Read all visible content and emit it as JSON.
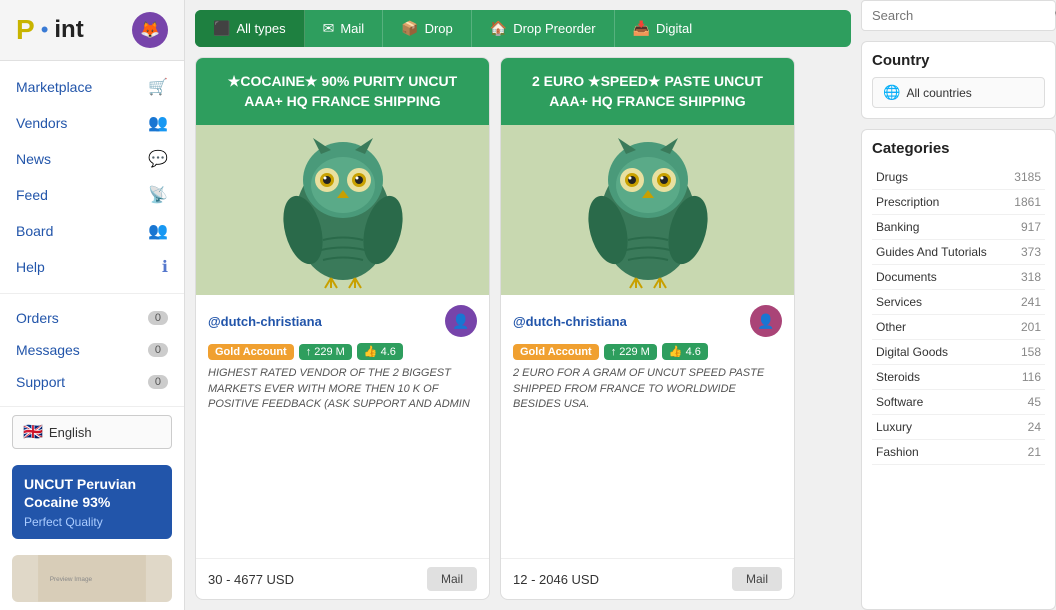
{
  "logo": {
    "p": "P",
    "dot": "•",
    "int": "int"
  },
  "sidebar": {
    "nav_items": [
      {
        "label": "Marketplace",
        "icon": "🛒",
        "badge": null
      },
      {
        "label": "Vendors",
        "icon": "👥",
        "badge": null
      },
      {
        "label": "News",
        "icon": "💬",
        "badge": null
      },
      {
        "label": "Feed",
        "icon": "📡",
        "badge": null
      },
      {
        "label": "Board",
        "icon": "👥",
        "badge": null
      },
      {
        "label": "Help",
        "icon": "ℹ",
        "badge": null
      }
    ],
    "account_items": [
      {
        "label": "Orders",
        "badge": "0"
      },
      {
        "label": "Messages",
        "badge": "0"
      },
      {
        "label": "Support",
        "badge": "0"
      }
    ],
    "language": "English",
    "promo_title": "UNCUT Peruvian Cocaine 93%",
    "promo_sub": "Perfect Quality"
  },
  "filters": [
    {
      "label": "All types",
      "icon": "⬛",
      "active": true
    },
    {
      "label": "Mail",
      "icon": "✉"
    },
    {
      "label": "Drop",
      "icon": "📦"
    },
    {
      "label": "Drop Preorder",
      "icon": "🏠"
    },
    {
      "label": "Digital",
      "icon": "📥"
    }
  ],
  "cards": [
    {
      "header": "★COCAINE★ 90% PURITY UNCUT AAA+ HQ FRANCE SHIPPING",
      "vendor": "@dutch-christiana",
      "level": "229 M",
      "rating": "4.6",
      "desc": "HIGHEST RATED VENDOR OF THE 2 BIGGEST MARKETS EVER WITH MORE THEN 10 K OF POSITIVE FEEDBACK (ASK SUPPORT AND ADMIN",
      "price": "30 - 4677 USD",
      "btn": "Mail"
    },
    {
      "header": "2 EURO ★SPEED★ PASTE UNCUT AAA+ HQ FRANCE SHIPPING",
      "vendor": "@dutch-christiana",
      "level": "229 M",
      "rating": "4.6",
      "desc": "2 EURO FOR A GRAM OF UNCUT SPEED PASTE SHIPPED FROM FRANCE TO WORLDWIDE BESIDES USA.",
      "price": "12 - 2046 USD",
      "btn": "Mail"
    }
  ],
  "right": {
    "search_placeholder": "Search",
    "country_section_title": "Country",
    "country_label": "All countries",
    "categories_title": "Categories",
    "categories": [
      {
        "name": "Drugs",
        "count": "3185"
      },
      {
        "name": "Prescription",
        "count": "1861"
      },
      {
        "name": "Banking",
        "count": "917"
      },
      {
        "name": "Guides And Tutorials",
        "count": "373"
      },
      {
        "name": "Documents",
        "count": "318"
      },
      {
        "name": "Services",
        "count": "241"
      },
      {
        "name": "Other",
        "count": "201"
      },
      {
        "name": "Digital Goods",
        "count": "158"
      },
      {
        "name": "Steroids",
        "count": "116"
      },
      {
        "name": "Software",
        "count": "45"
      },
      {
        "name": "Luxury",
        "count": "24"
      },
      {
        "name": "Fashion",
        "count": "21"
      }
    ]
  }
}
